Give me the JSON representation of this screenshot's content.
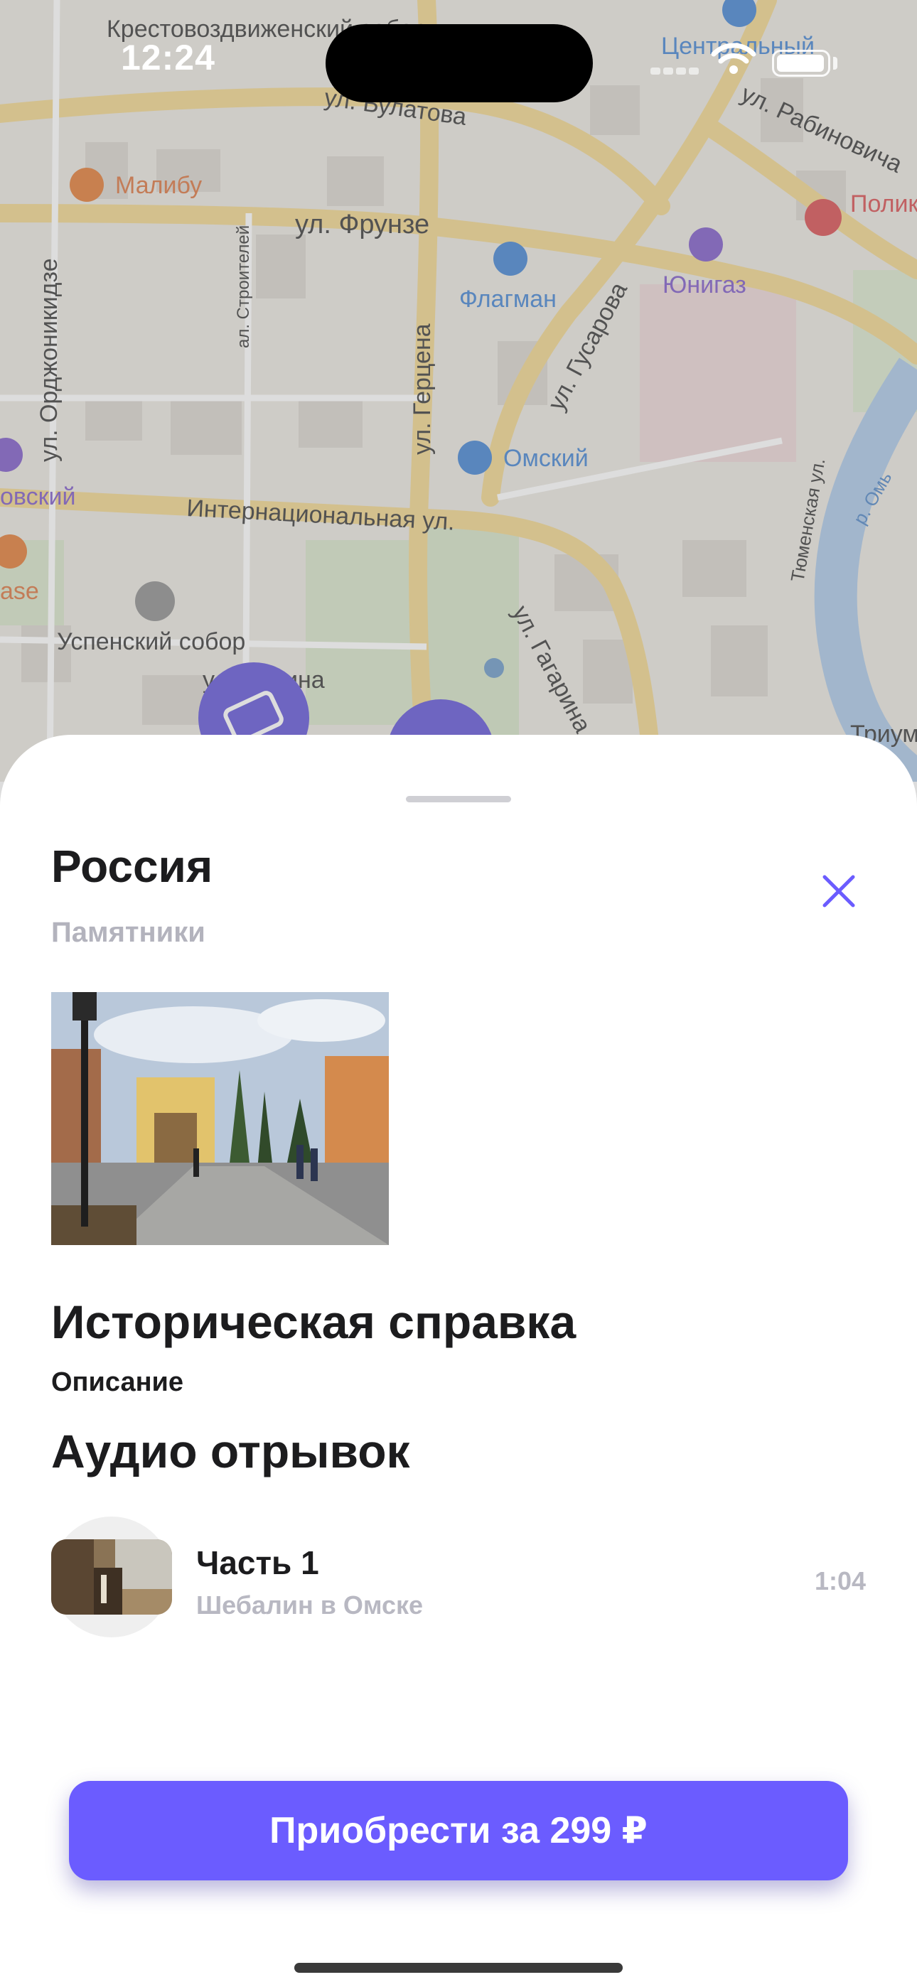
{
  "status_bar": {
    "time": "12:24"
  },
  "map": {
    "labels": {
      "krestovozdvizh": "Крестовоздвиженский собор",
      "malibu": "Малибу",
      "frunze": "ул. Фрунзе",
      "bulatova": "ул. Булатова",
      "rabinovicha": "ул. Рабиновича",
      "centralny": "Центральный",
      "yunigaz": "Юнигаз",
      "polik": "Полик КМХЦ",
      "flagman": "Флагман",
      "stroiteley": "ал. Строителей",
      "ordzhonikidze": "ул. Орджоникидзе",
      "gertsena": "ул. Герцена",
      "gusarova": "ул. Гусарова",
      "omsky": "Омский",
      "tyumenskaya": "Тюменская ул.",
      "om": "р. Омь",
      "internatsionalnaya": "Интернациональная ул.",
      "uspensky": "Успенский собор",
      "lenina": "ул. Ленина",
      "gagarina": "ул. Гагарина",
      "left1": "овский",
      "left2": "ase",
      "triumph": "Триум"
    }
  },
  "sheet": {
    "title": "Россия",
    "category": "Памятники",
    "history_heading": "Историческая справка",
    "description": "Описание",
    "audio_heading": "Аудио отрывок",
    "track": {
      "title": "Часть 1",
      "subtitle": "Шебалин в Омске",
      "duration": "1:04"
    },
    "buy_label": "Приобрести за 299 ₽"
  },
  "colors": {
    "accent": "#6b5cff",
    "map_bg": "#e7e3dc",
    "road": "#f3d98c",
    "poi_blue": "#3d7fd0"
  }
}
